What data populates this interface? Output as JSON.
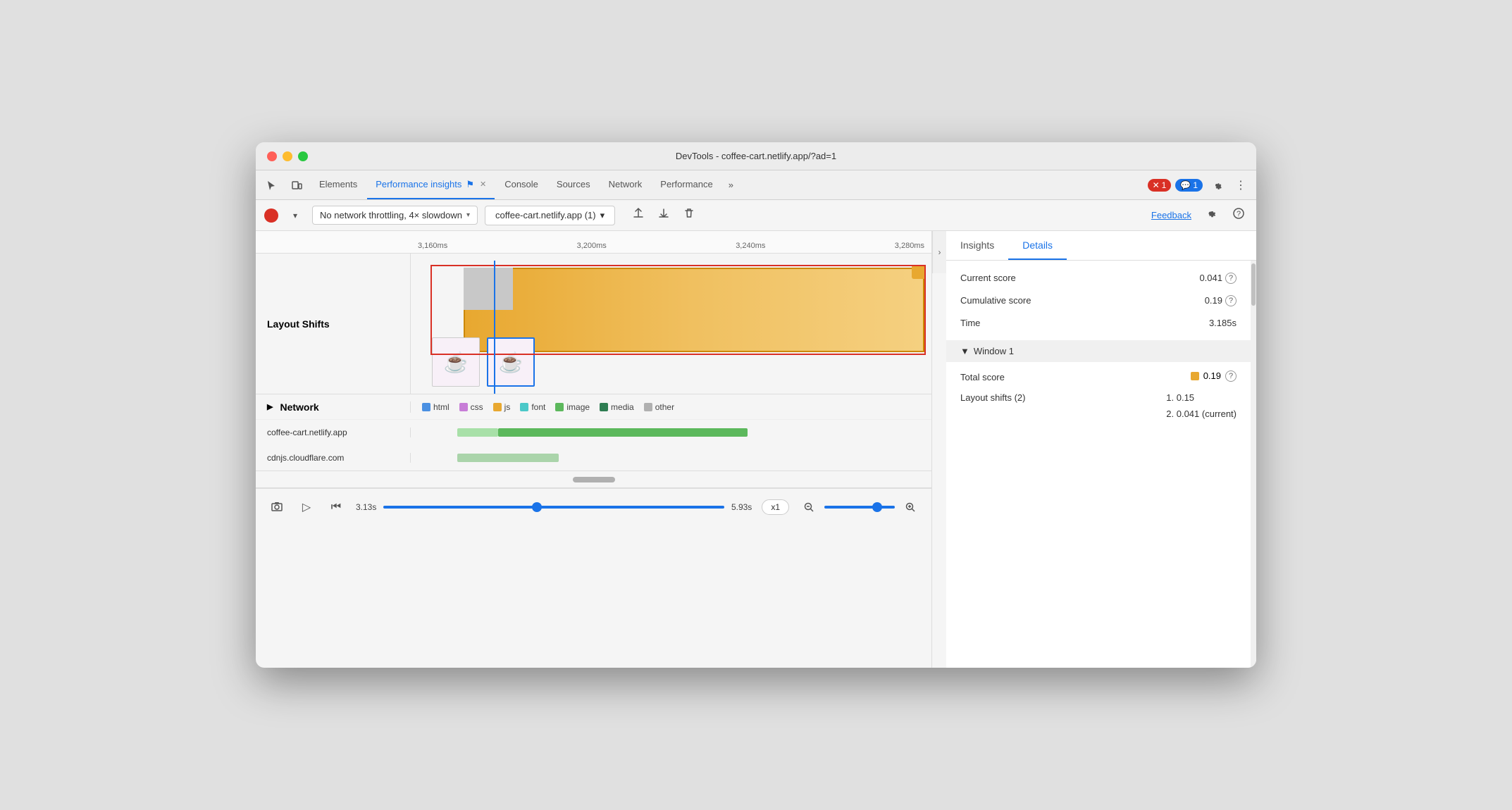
{
  "window": {
    "title": "DevTools - coffee-cart.netlify.app/?ad=1"
  },
  "tabs": {
    "items": [
      {
        "id": "elements",
        "label": "Elements",
        "active": false
      },
      {
        "id": "performance-insights",
        "label": "Performance insights",
        "active": true,
        "has_close": true,
        "has_flag": true
      },
      {
        "id": "console",
        "label": "Console",
        "active": false
      },
      {
        "id": "sources",
        "label": "Sources",
        "active": false
      },
      {
        "id": "network",
        "label": "Network",
        "active": false
      },
      {
        "id": "performance",
        "label": "Performance",
        "active": false
      }
    ],
    "more_label": "»",
    "error_count": "1",
    "info_count": "1"
  },
  "toolbar": {
    "throttle_label": "No network throttling, 4× slowdown",
    "url_label": "coffee-cart.netlify.app (1)",
    "feedback_label": "Feedback",
    "chevron_down": "▾"
  },
  "timeline": {
    "ticks": [
      "3,160ms",
      "3,200ms",
      "3,240ms",
      "3,280ms"
    ]
  },
  "layout_shifts": {
    "label": "Layout Shifts"
  },
  "network": {
    "label": "Network",
    "legend": [
      {
        "id": "html",
        "label": "html",
        "color": "#4a90e2"
      },
      {
        "id": "css",
        "label": "css",
        "color": "#c77dd7"
      },
      {
        "id": "js",
        "label": "js",
        "color": "#e8a830"
      },
      {
        "id": "font",
        "label": "font",
        "color": "#4bc8c8"
      },
      {
        "id": "image",
        "label": "image",
        "color": "#5cb85c"
      },
      {
        "id": "media",
        "label": "media",
        "color": "#2e7d52"
      },
      {
        "id": "other",
        "label": "other",
        "color": "#b0b0b0"
      }
    ],
    "items": [
      {
        "label": "coffee-cart.netlify.app",
        "bar_start": "8%",
        "bar_width": "57%",
        "bar_color": "#7bc87b"
      },
      {
        "label": "cdnjs.cloudflare.com",
        "bar_start": "8%",
        "bar_width": "20%",
        "bar_color": "#aad4aa"
      }
    ]
  },
  "controls": {
    "time_start": "3.13s",
    "time_end": "5.93s",
    "slider_position": "45%",
    "speed_label": "x1",
    "zoom_position": "75%"
  },
  "right_panel": {
    "tabs": [
      {
        "id": "insights",
        "label": "Insights",
        "active": false
      },
      {
        "id": "details",
        "label": "Details",
        "active": true
      }
    ],
    "metrics": [
      {
        "name": "Current score",
        "value": "0.041",
        "has_help": true
      },
      {
        "name": "Cumulative score",
        "value": "0.19",
        "has_help": true
      },
      {
        "name": "Time",
        "value": "3.185s",
        "has_help": false
      }
    ],
    "window_section": {
      "label": "Window 1",
      "total_score_label": "Total score",
      "total_score_value": "0.19",
      "layout_shifts_label": "Layout shifts (2)",
      "layout_shifts_items": [
        "1. 0.15",
        "2. 0.041 (current)"
      ]
    }
  }
}
